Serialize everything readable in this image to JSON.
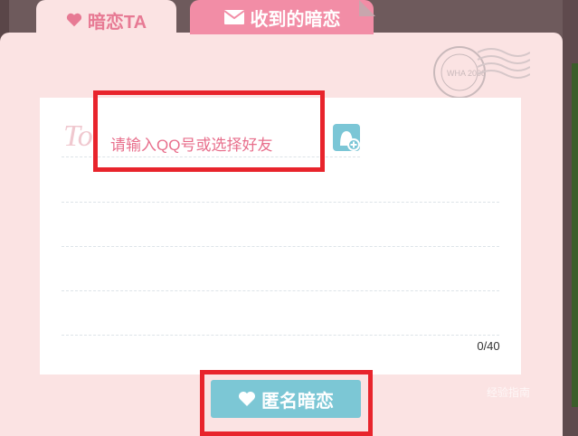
{
  "tabs": [
    {
      "label": "暗恋TA",
      "icon": "heart-icon",
      "active": true
    },
    {
      "label": "收到的暗恋",
      "icon": "mail-icon",
      "active": false
    }
  ],
  "form": {
    "to_label": "To",
    "recipient_placeholder": "请输入QQ号或选择好友",
    "add_friend_icon": "add-friend-icon",
    "char_counter": "0/40",
    "submit_label": "匿名暗恋",
    "submit_icon": "heart-icon"
  },
  "postmark": {
    "icon": "postmark-stamp-icon",
    "text": "WHA 2008"
  },
  "watermark": "经验指南",
  "colors": {
    "pink_accent": "#e77a94",
    "tab_inactive": "#f28da6",
    "card_bg": "#fbe3e3",
    "button_teal": "#7cc7d5",
    "highlight_red": "#e8242c"
  }
}
